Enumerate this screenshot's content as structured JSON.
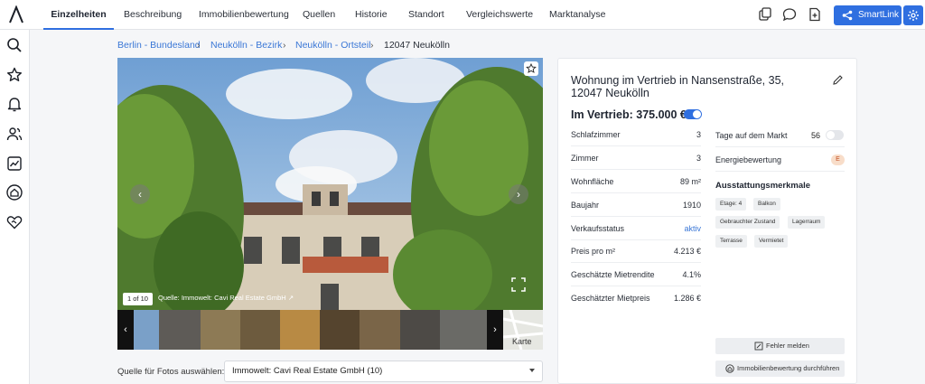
{
  "topbar": {
    "tabs": [
      {
        "label": "Einzelheiten",
        "active": true
      },
      {
        "label": "Beschreibung"
      },
      {
        "label": "Immobilienbewertung"
      },
      {
        "label": "Quellen"
      },
      {
        "label": "Historie"
      },
      {
        "label": "Standort"
      },
      {
        "label": "Vergleichswerte"
      },
      {
        "label": "Marktanalyse"
      }
    ],
    "smartlink_label": "SmartLink",
    "accent": "#2f6fe0"
  },
  "sidebar": {
    "icons": [
      "search-icon",
      "star-icon",
      "bell-icon",
      "users-icon",
      "chart-icon",
      "home-heart-icon",
      "heart-handshake-icon"
    ]
  },
  "breadcrumb": [
    {
      "label": "Berlin - Bundesland",
      "link": true
    },
    {
      "label": "Neukölln - Bezirk",
      "link": true
    },
    {
      "label": "Neukölln - Ortsteil",
      "link": true
    },
    {
      "label": "12047 Neukölln",
      "link": false
    }
  ],
  "gallery": {
    "counter": "1 of 10",
    "source": "Quelle: Immowelt: Cavi Real Estate GmbH",
    "map_label": "Karte"
  },
  "photo_source": {
    "label": "Quelle für Fotos auswählen:",
    "selected": "Immowelt: Cavi Real Estate GmbH (10)"
  },
  "listing": {
    "title": "Wohnung im Vertrieb in Nansenstraße, 35, 12047 Neukölln",
    "price": "Im Vertrieb: 375.000 €",
    "price_toggle_on": true,
    "facts": [
      {
        "label": "Schlafzimmer",
        "value": "3"
      },
      {
        "label": "Zimmer",
        "value": "3"
      },
      {
        "label": "Wohnfläche",
        "value": "89 m²"
      },
      {
        "label": "Baujahr",
        "value": "1910"
      },
      {
        "label": "Verkaufsstatus",
        "value": "aktiv",
        "link": true
      },
      {
        "label": "Preis pro m²",
        "value": "4.213 €"
      },
      {
        "label": "Geschätzte Mietrendite",
        "value": "4.1%"
      },
      {
        "label": "Geschätzter Mietpreis",
        "value": "1.286 €"
      }
    ],
    "days_on_market": {
      "label": "Tage auf dem Markt",
      "value": "56",
      "toggle_on": false
    },
    "energy": {
      "label": "Energiebewertung",
      "value": "E"
    },
    "features_title": "Ausstattungsmerkmale",
    "features": [
      "Etage: 4",
      "Balkon",
      "Gebrauchter Zustand",
      "Lagerraum",
      "Terrasse",
      "Vermietet"
    ],
    "report_error": "Fehler melden",
    "run_valuation": "Immobilienbewertung durchführen"
  }
}
